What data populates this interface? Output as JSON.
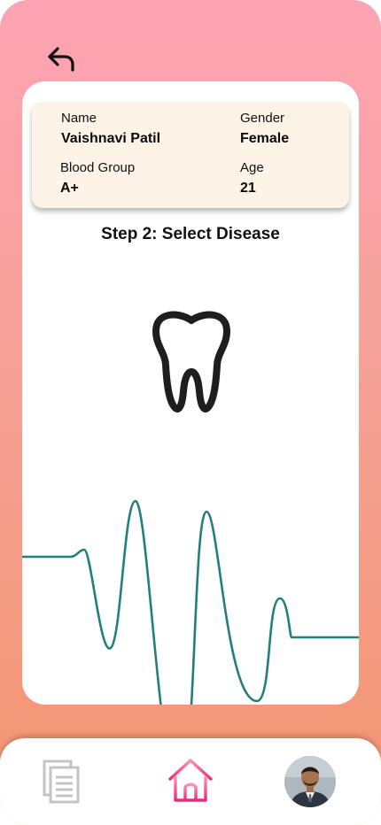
{
  "header": {
    "back_icon": "back-arrow-icon"
  },
  "patient": {
    "name_label": "Name",
    "name_value": "Vaishnavi Patil",
    "gender_label": "Gender",
    "gender_value": "Female",
    "blood_group_label": "Blood Group",
    "blood_group_value": "A+",
    "age_label": "Age",
    "age_value": "21"
  },
  "step_title": "Step 2: Select Disease",
  "illustration": {
    "icon": "tooth-icon",
    "wave_color": "#237f7c"
  },
  "bottom_nav": {
    "items": [
      "documents-icon",
      "home-icon",
      "profile-avatar"
    ],
    "active": "home-icon",
    "accent": "#f0287a"
  },
  "colors": {
    "gradient_top": "#fea3b4",
    "gradient_bottom": "#f2956f",
    "info_card": "#fdf3e7"
  }
}
